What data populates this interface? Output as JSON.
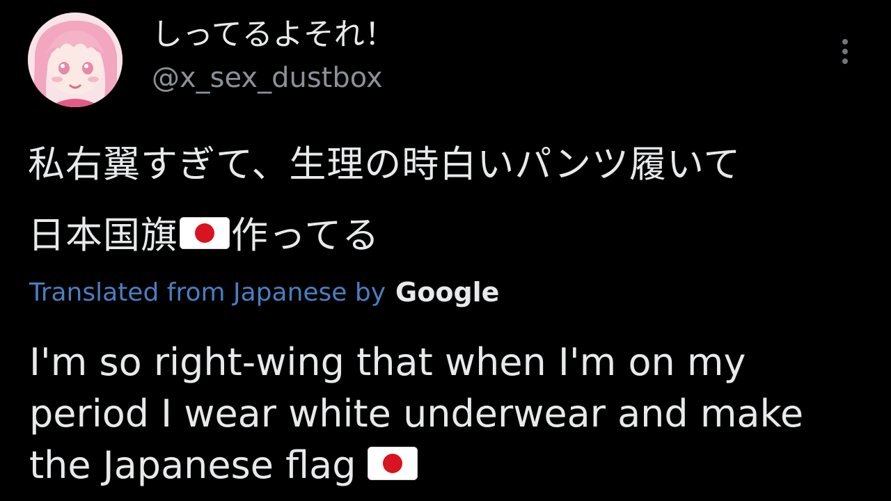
{
  "author": {
    "display_name": "しってるよそれ！",
    "handle": "@x_sex_dustbox"
  },
  "more_menu": {
    "icon": "more-vertical-icon"
  },
  "tweet": {
    "original_line1": "私右翼すぎて、生理の時白いパンツ履いて",
    "original_line2_part1": "日本国旗",
    "original_line2_part2": "作ってる",
    "flag_icon": "japan-flag-icon",
    "translated_from": "Translated from Japanese by",
    "translator_brand": "Google",
    "translation": "I'm so right-wing that when I'm on my period I wear white underwear and make the Japanese flag"
  },
  "colors": {
    "background": "#000000",
    "primary_text": "#e7e9ea",
    "handle_text": "#8b9196",
    "translated_label": "#4a7fc1",
    "flag_red": "#d7141f"
  }
}
